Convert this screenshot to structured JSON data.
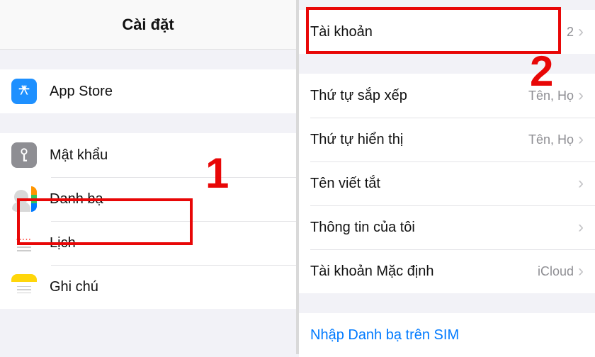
{
  "left": {
    "title": "Cài đặt",
    "group1": [
      {
        "label": "App Store",
        "icon": "appstore"
      }
    ],
    "group2": [
      {
        "label": "Mật khẩu",
        "icon": "password"
      },
      {
        "label": "Danh bạ",
        "icon": "contacts"
      },
      {
        "label": "Lịch",
        "icon": "calendar"
      },
      {
        "label": "Ghi chú",
        "icon": "notes"
      }
    ]
  },
  "right": {
    "group1": [
      {
        "label": "Tài khoản",
        "value": "2"
      }
    ],
    "group2": [
      {
        "label": "Thứ tự sắp xếp",
        "value": "Tên, Họ"
      },
      {
        "label": "Thứ tự hiển thị",
        "value": "Tên, Họ"
      },
      {
        "label": "Tên viết tắt",
        "value": ""
      },
      {
        "label": "Thông tin của tôi",
        "value": ""
      },
      {
        "label": "Tài khoản Mặc định",
        "value": "iCloud"
      }
    ],
    "group3": [
      {
        "label": "Nhập Danh bạ trên SIM"
      }
    ]
  },
  "annotations": {
    "step1": "1",
    "step2": "2"
  }
}
